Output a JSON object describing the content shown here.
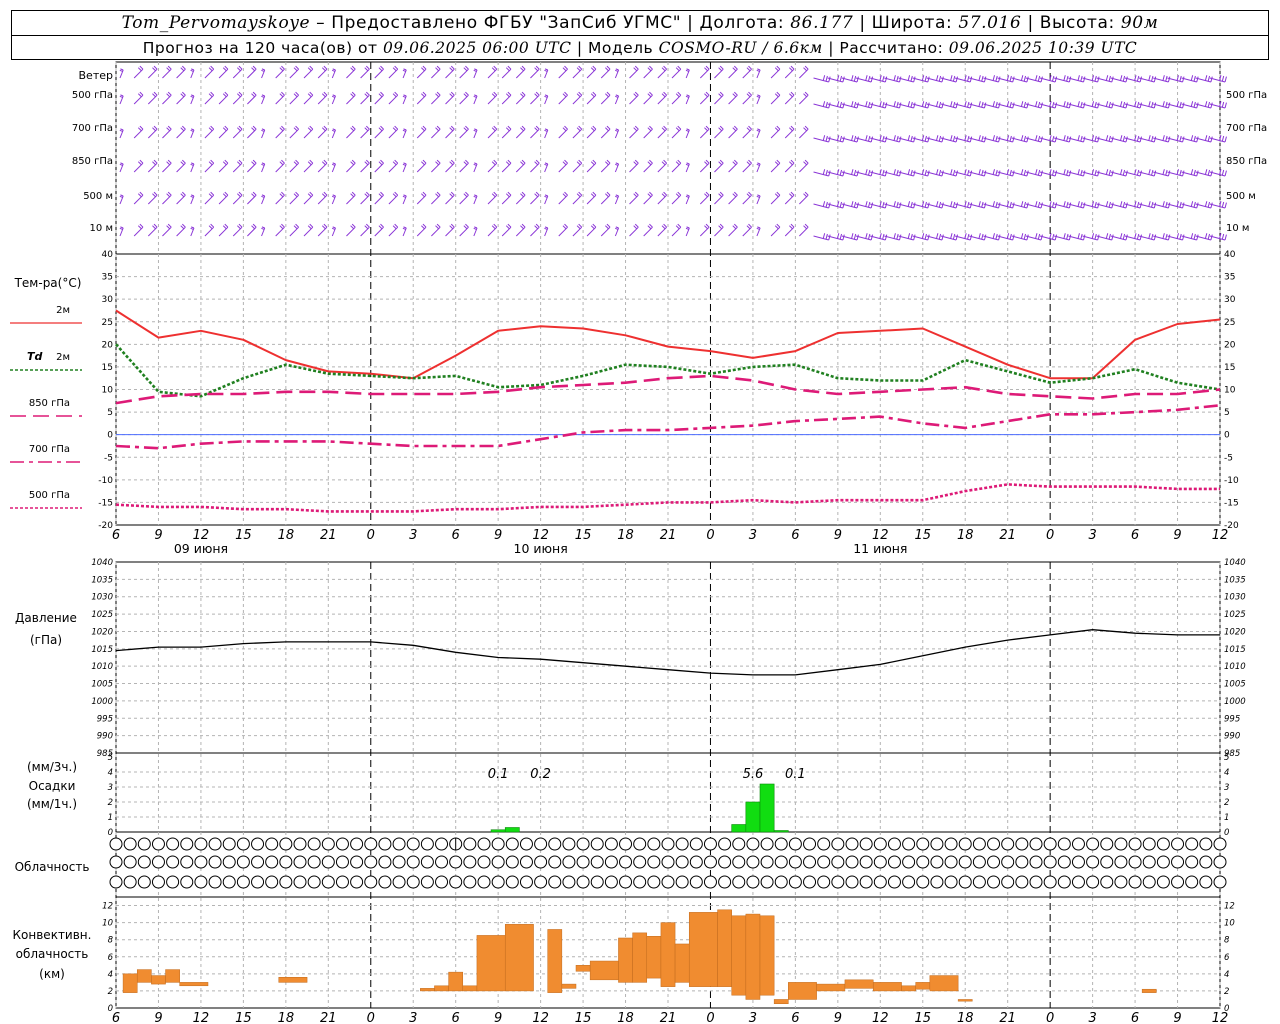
{
  "header": {
    "station": "Tom_Pervomayskoye",
    "provider": " – Предоставлено ФГБУ \"ЗапСиб УГМС\" | ",
    "lon_label": "Долгота: ",
    "lon": "86.177",
    "lat_label": " | Широта: ",
    "lat": "57.016",
    "alt_label": " | Высота: ",
    "alt": "90м",
    "forecast_label": "Прогноз на 120 часа(ов) от ",
    "forecast_start": "09.06.2025 06:00 UTC",
    "model_label": " | Модель ",
    "model": "COSMO-RU / 6.6км",
    "calc_label": " | Рассчитано: ",
    "calc_time": "09.06.2025 10:39 UTC"
  },
  "colors": {
    "t2m": "#ee3030",
    "td2m": "#208020",
    "t850": "#dd1a77",
    "t700": "#dd1a77",
    "t500": "#dd1a77",
    "wind": "#8a35d6",
    "pressure": "#000000",
    "precip": "#11dd11",
    "convective": "#f08c30",
    "zero_line": "#4d6dff",
    "grid": "#b4b4b4"
  },
  "panel_labels": {
    "wind_title": "Ветер",
    "wind_levels": [
      "500 гПа",
      "700 гПа",
      "850 гПа",
      "500 м",
      "10 м"
    ],
    "temp_title": "Тем-ра(°C)",
    "t2m": "2м",
    "td_prefix": "Td",
    "td2m": "2м",
    "t850": "850 гПа",
    "t700": "700 гПа",
    "t500": "500 гПа",
    "pressure_title": "Давление",
    "pressure_unit": "(гПа)",
    "precip_unit3": "(мм/3ч.)",
    "precip_title": "Осадки",
    "precip_unit1": "(мм/1ч.)",
    "cloud_title": "Облачность",
    "conv_title1": "Конвективн.",
    "conv_title2": "облачность",
    "conv_unit": "(км)"
  },
  "time_axis": {
    "hour_ticks": [
      "6",
      "9",
      "12",
      "15",
      "18",
      "21",
      "0",
      "3",
      "6",
      "9",
      "12",
      "15",
      "18",
      "21",
      "0",
      "3",
      "6",
      "9",
      "12",
      "15",
      "18",
      "21",
      "0",
      "3",
      "6",
      "9",
      "12"
    ],
    "day_labels": [
      "09 июня",
      "10 июня",
      "11 июня"
    ],
    "day_label_hours": [
      6,
      30,
      54
    ]
  },
  "chart_data": [
    {
      "type": "line",
      "title": "Тем-ра(°C)",
      "x_hours": [
        0,
        3,
        6,
        9,
        12,
        15,
        18,
        21,
        24,
        27,
        30,
        33,
        36,
        39,
        42,
        45,
        48,
        51,
        54,
        57,
        60,
        63,
        66,
        69,
        72,
        75,
        78
      ],
      "ylim": [
        -20,
        40
      ],
      "y_ticks": [
        -20,
        -15,
        -10,
        -5,
        0,
        5,
        10,
        15,
        20,
        25,
        30,
        35,
        40
      ],
      "series": [
        {
          "name": "2м",
          "style": "solid",
          "values": [
            27.5,
            21.5,
            23.0,
            21.0,
            16.5,
            14.0,
            13.5,
            12.5,
            17.5,
            23.0,
            24.0,
            23.5,
            22.0,
            19.5,
            18.5,
            17.0,
            18.5,
            22.5,
            23.0,
            23.5,
            19.5,
            15.5,
            12.5,
            12.5,
            21.0,
            24.5,
            25.5
          ]
        },
        {
          "name": "Td 2м",
          "style": "dotted",
          "values": [
            20.0,
            9.5,
            8.5,
            12.5,
            15.5,
            13.5,
            13.0,
            12.5,
            13.0,
            10.5,
            11.0,
            13.0,
            15.5,
            15.0,
            13.5,
            15.0,
            15.5,
            12.5,
            12.0,
            12.0,
            16.5,
            14.0,
            11.5,
            12.5,
            14.5,
            11.5,
            10.0
          ]
        },
        {
          "name": "850 гПа",
          "style": "dashed",
          "values": [
            7.0,
            8.5,
            9.0,
            9.0,
            9.5,
            9.5,
            9.0,
            9.0,
            9.0,
            9.5,
            10.5,
            11.0,
            11.5,
            12.5,
            13.0,
            12.0,
            10.0,
            9.0,
            9.5,
            10.0,
            10.5,
            9.0,
            8.5,
            8.0,
            9.0,
            9.0,
            10.0
          ]
        },
        {
          "name": "700 гПа",
          "style": "dashdot",
          "values": [
            -2.5,
            -3.0,
            -2.0,
            -1.5,
            -1.5,
            -1.5,
            -2.0,
            -2.5,
            -2.5,
            -2.5,
            -1.0,
            0.5,
            1.0,
            1.0,
            1.5,
            2.0,
            3.0,
            3.5,
            4.0,
            2.5,
            1.5,
            3.0,
            4.5,
            4.5,
            5.0,
            5.5,
            6.5
          ]
        },
        {
          "name": "500 гПа",
          "style": "dotted",
          "values": [
            -15.5,
            -16.0,
            -16.0,
            -16.5,
            -16.5,
            -17.0,
            -17.0,
            -17.0,
            -16.5,
            -16.5,
            -16.0,
            -16.0,
            -15.5,
            -15.0,
            -15.0,
            -14.5,
            -15.0,
            -14.5,
            -14.5,
            -14.5,
            -12.5,
            -11.0,
            -11.5,
            -11.5,
            -11.5,
            -12.0,
            -12.0
          ]
        }
      ]
    },
    {
      "type": "line",
      "title": "Давление",
      "ylabel": "(гПа)",
      "x_hours": [
        0,
        3,
        6,
        9,
        12,
        15,
        18,
        21,
        24,
        27,
        30,
        33,
        36,
        39,
        42,
        45,
        48,
        51,
        54,
        57,
        60,
        63,
        66,
        69,
        72,
        75,
        78
      ],
      "ylim": [
        985,
        1040
      ],
      "y_ticks": [
        985,
        990,
        995,
        1000,
        1005,
        1010,
        1015,
        1020,
        1025,
        1030,
        1035,
        1040
      ],
      "series": [
        {
          "name": "Давление",
          "values": [
            1014.5,
            1015.5,
            1015.5,
            1016.5,
            1017.0,
            1017.0,
            1017.0,
            1016.0,
            1014.0,
            1012.5,
            1012.0,
            1011.0,
            1010.0,
            1009.0,
            1008.0,
            1007.5,
            1007.5,
            1009.0,
            1010.5,
            1013.0,
            1015.5,
            1017.5,
            1019.0,
            1020.5,
            1019.5,
            1019.0,
            1019.0
          ]
        }
      ]
    },
    {
      "type": "bar",
      "title": "Осадки",
      "ylabel": "(мм/3ч.) (мм/1ч.)",
      "ylim": [
        0,
        5
      ],
      "y_ticks": [
        0,
        1,
        2,
        3,
        4,
        5
      ],
      "bars": [
        {
          "hour": 27,
          "value": 0.15
        },
        {
          "hour": 28,
          "value": 0.3
        },
        {
          "hour": 44,
          "value": 0.5
        },
        {
          "hour": 45,
          "value": 2.0
        },
        {
          "hour": 46,
          "value": 3.2
        },
        {
          "hour": 47,
          "value": 0.1
        }
      ],
      "annotations": [
        {
          "hour": 27,
          "text": "0.1"
        },
        {
          "hour": 30,
          "text": "0.2"
        },
        {
          "hour": 45,
          "text": "5.6"
        },
        {
          "hour": 48,
          "text": "0.1"
        }
      ]
    },
    {
      "type": "bar",
      "title": "Конвективн. облачность",
      "ylabel": "(км)",
      "ylim": [
        0,
        13
      ],
      "y_ticks": [
        0,
        2,
        4,
        6,
        8,
        10,
        12
      ],
      "bars": [
        {
          "start": 0.5,
          "end": 1.5,
          "bottom": 1.8,
          "top": 4.0
        },
        {
          "start": 1.5,
          "end": 2.5,
          "bottom": 3.0,
          "top": 4.5
        },
        {
          "start": 2.5,
          "end": 3.5,
          "bottom": 2.8,
          "top": 3.8
        },
        {
          "start": 3.5,
          "end": 4.5,
          "bottom": 3.0,
          "top": 4.5
        },
        {
          "start": 4.5,
          "end": 6.5,
          "bottom": 2.6,
          "top": 3.0
        },
        {
          "start": 11.5,
          "end": 13.5,
          "bottom": 3.0,
          "top": 3.6
        },
        {
          "start": 21.5,
          "end": 22.5,
          "bottom": 2.0,
          "top": 2.3
        },
        {
          "start": 22.5,
          "end": 23.5,
          "bottom": 2.0,
          "top": 2.6
        },
        {
          "start": 23.5,
          "end": 24.5,
          "bottom": 2.0,
          "top": 4.2
        },
        {
          "start": 24.5,
          "end": 25.5,
          "bottom": 2.0,
          "top": 2.6
        },
        {
          "start": 25.5,
          "end": 27.5,
          "bottom": 2.0,
          "top": 8.5
        },
        {
          "start": 27.5,
          "end": 29.5,
          "bottom": 2.0,
          "top": 9.8
        },
        {
          "start": 30.5,
          "end": 31.5,
          "bottom": 1.8,
          "top": 9.2
        },
        {
          "start": 31.5,
          "end": 32.5,
          "bottom": 2.3,
          "top": 2.8
        },
        {
          "start": 32.5,
          "end": 33.5,
          "bottom": 4.3,
          "top": 5.0
        },
        {
          "start": 33.5,
          "end": 35.5,
          "bottom": 3.3,
          "top": 5.5
        },
        {
          "start": 35.5,
          "end": 36.5,
          "bottom": 3.0,
          "top": 8.2
        },
        {
          "start": 36.5,
          "end": 37.5,
          "bottom": 3.0,
          "top": 8.8
        },
        {
          "start": 37.5,
          "end": 38.5,
          "bottom": 3.5,
          "top": 8.4
        },
        {
          "start": 38.5,
          "end": 39.5,
          "bottom": 2.5,
          "top": 10.0
        },
        {
          "start": 39.5,
          "end": 40.5,
          "bottom": 3.0,
          "top": 7.5
        },
        {
          "start": 40.5,
          "end": 42.5,
          "bottom": 2.5,
          "top": 11.2
        },
        {
          "start": 42.5,
          "end": 43.5,
          "bottom": 2.5,
          "top": 11.5
        },
        {
          "start": 43.5,
          "end": 44.5,
          "bottom": 1.5,
          "top": 10.8
        },
        {
          "start": 44.5,
          "end": 45.5,
          "bottom": 1.0,
          "top": 11.0
        },
        {
          "start": 45.5,
          "end": 46.5,
          "bottom": 1.5,
          "top": 10.8
        },
        {
          "start": 46.5,
          "end": 47.5,
          "bottom": 0.5,
          "top": 1.0
        },
        {
          "start": 47.5,
          "end": 49.5,
          "bottom": 1.0,
          "top": 3.0
        },
        {
          "start": 49.5,
          "end": 51.5,
          "bottom": 2.0,
          "top": 2.8
        },
        {
          "start": 51.5,
          "end": 53.5,
          "bottom": 2.3,
          "top": 3.3
        },
        {
          "start": 53.5,
          "end": 55.5,
          "bottom": 2.0,
          "top": 3.0
        },
        {
          "start": 55.5,
          "end": 56.5,
          "bottom": 2.0,
          "top": 2.6
        },
        {
          "start": 56.5,
          "end": 57.5,
          "bottom": 2.2,
          "top": 3.0
        },
        {
          "start": 57.5,
          "end": 59.5,
          "bottom": 2.0,
          "top": 3.8
        },
        {
          "start": 59.5,
          "end": 60.5,
          "bottom": 0.8,
          "top": 1.0
        },
        {
          "start": 72.5,
          "end": 73.5,
          "bottom": 1.8,
          "top": 2.2
        }
      ]
    }
  ],
  "cloudiness": {
    "rows": [
      "0000000000000000000000002000000000000000000000000000000000000000000000000000000",
      "0000000000000000000000000000000000000000000000000000000000000000000000000000000",
      "0000000000000000000000000000000000000000000000000000000000000000000000000000000"
    ]
  }
}
